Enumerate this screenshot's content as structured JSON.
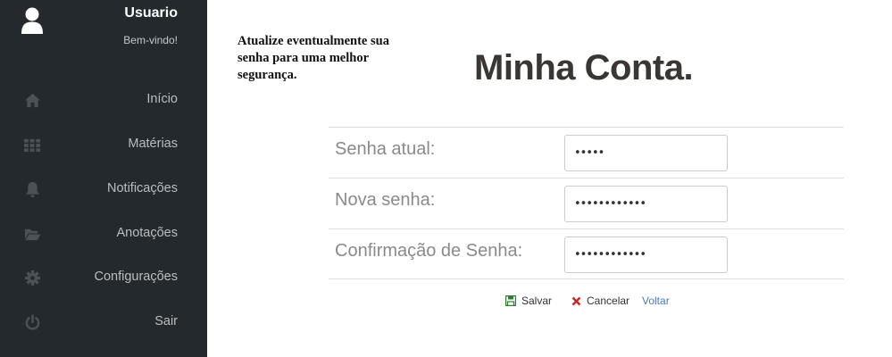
{
  "sidebar": {
    "user_name": "Usuario",
    "welcome": "Bem-vindo!",
    "items": [
      {
        "label": "Início",
        "icon": "home-icon"
      },
      {
        "label": "Matérias",
        "icon": "grid-icon"
      },
      {
        "label": "Notificações",
        "icon": "bell-icon"
      },
      {
        "label": "Anotações",
        "icon": "folder-open-icon"
      },
      {
        "label": "Configurações",
        "icon": "gear-icon"
      },
      {
        "label": "Sair",
        "icon": "power-icon"
      }
    ]
  },
  "main": {
    "tip": "Atualize eventualmente sua senha para uma melhor segurança.",
    "title": "Minha Conta.",
    "fields": [
      {
        "label": "Senha atual:",
        "value": "•••••"
      },
      {
        "label": "Nova senha:",
        "value": "••••••••••••"
      },
      {
        "label": "Confirmação de Senha:",
        "value": "••••••••••••"
      }
    ],
    "actions": {
      "save": "Salvar",
      "cancel": "Cancelar",
      "back": "Voltar"
    }
  },
  "colors": {
    "sidebar_bg": "#24292d",
    "save_icon": "#2e7d32",
    "cancel_icon": "#c62828",
    "link": "#4a7bb0"
  }
}
